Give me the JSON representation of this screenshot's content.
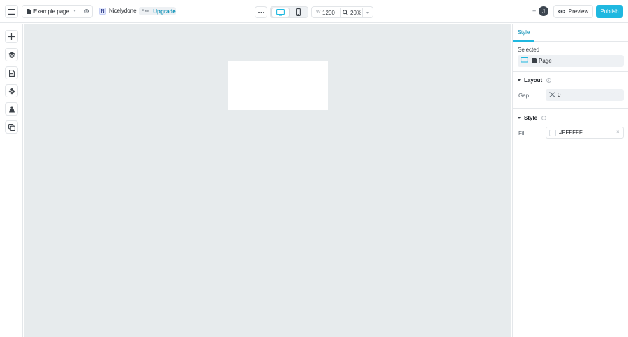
{
  "topbar": {
    "page_name": "Example page",
    "project": {
      "logo_letter": "N",
      "name": "Nicelydone"
    },
    "plan": {
      "tier": "Free",
      "upgrade_label": "Upgrade"
    },
    "canvas_width_prefix": "W",
    "canvas_width": "1200",
    "zoom": "20%",
    "collaborator_add": "+",
    "avatar_letter": "J",
    "preview_label": "Preview",
    "publish_label": "Publish"
  },
  "left_toolbar": {
    "tools": [
      "add",
      "layers",
      "pages",
      "components",
      "assets",
      "cms"
    ]
  },
  "canvas": {
    "background": "#e7ebed",
    "frame_fill": "#FFFFFF"
  },
  "right_panel": {
    "active_tab": "Style",
    "selected_label": "Selected",
    "selected_item": "Page",
    "layout": {
      "title": "Layout",
      "gap_label": "Gap",
      "gap_value": "0"
    },
    "style": {
      "title": "Style",
      "fill_label": "Fill",
      "fill_value": "#FFFFFF",
      "clear_glyph": "×"
    }
  },
  "colors": {
    "accent": "#1fb8e0",
    "accent_text": "#0d92b8"
  }
}
